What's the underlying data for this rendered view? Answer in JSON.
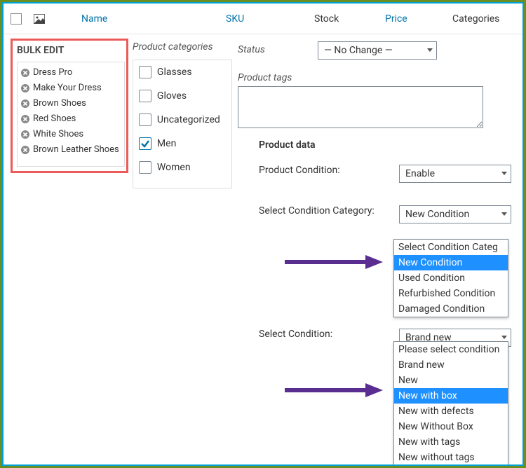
{
  "columns": {
    "checkbox": "",
    "image": "",
    "name": "Name",
    "sku": "SKU",
    "stock": "Stock",
    "price": "Price",
    "categories": "Categories"
  },
  "bulk": {
    "title": "BULK EDIT",
    "items": [
      "Dress Pro",
      "Make Your Dress",
      "Brown Shoes",
      "Red Shoes",
      "White Shoes",
      "Brown Leather Shoes"
    ]
  },
  "cats": {
    "title": "Product categories",
    "items": [
      {
        "label": "Glasses",
        "checked": false
      },
      {
        "label": "Gloves",
        "checked": false
      },
      {
        "label": "Uncategorized",
        "checked": false
      },
      {
        "label": "Men",
        "checked": true
      },
      {
        "label": "Women",
        "checked": false
      }
    ]
  },
  "status": {
    "label": "Status",
    "value": "— No Change —"
  },
  "tags": {
    "label": "Product tags"
  },
  "pdata_title": "Product data",
  "pd": {
    "condition": {
      "label": "Product Condition:",
      "value": "Enable"
    },
    "condition_cat": {
      "label": "Select Condition Category:",
      "value": "New Condition"
    },
    "select_condition": {
      "label": "Select Condition:",
      "value": "Brand new"
    }
  },
  "dd_cat": {
    "items": [
      "Select Condition Categ",
      "New Condition",
      "Used Condition",
      "Refurbished Condition",
      "Damaged Condition"
    ],
    "selected": "New Condition"
  },
  "dd_cond": {
    "items": [
      "Please select condition",
      "Brand new",
      "New",
      "New with box",
      "New with defects",
      "New Without Box",
      "New with tags",
      "New without tags"
    ],
    "selected": "New with box"
  }
}
